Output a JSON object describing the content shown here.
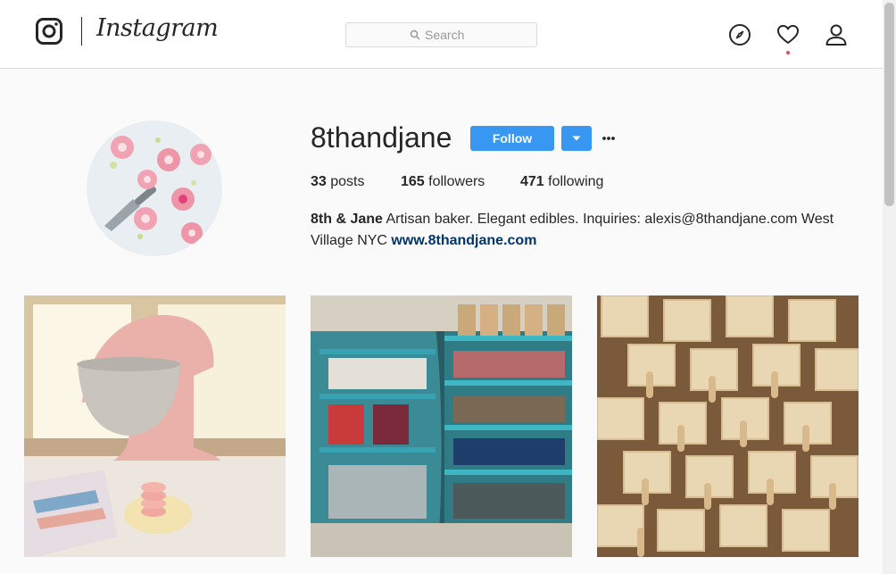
{
  "header": {
    "wordmark": "Instagram",
    "search": {
      "placeholder": "Search"
    },
    "icons": [
      "instagram-glyph-icon",
      "search-icon",
      "compass-icon",
      "heart-icon",
      "person-icon"
    ]
  },
  "profile": {
    "username": "8thandjane",
    "follow_label": "Follow",
    "stats": {
      "posts_count": "33",
      "posts_label": "posts",
      "followers_count": "165",
      "followers_label": "followers",
      "following_count": "471",
      "following_label": "following"
    },
    "bio": {
      "name": "8th & Jane",
      "text": "Artisan baker. Elegant edibles. Inquiries: alexis@8thandjane.com West Village NYC",
      "link": "www.8thandjane.com"
    }
  },
  "colors": {
    "accent": "#3897f0",
    "link": "#003569",
    "border": "#dbdbdb",
    "notification": "#ed4956"
  }
}
